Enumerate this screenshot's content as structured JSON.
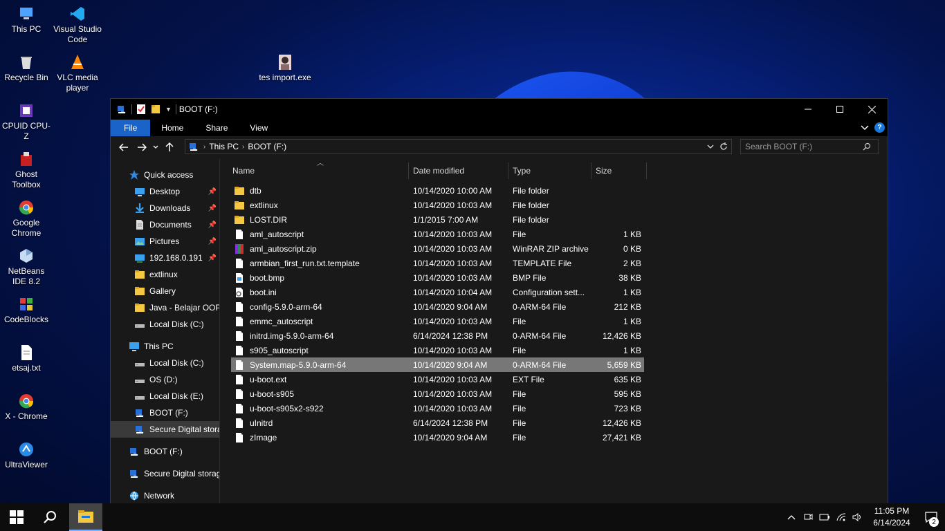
{
  "desktop": {
    "icons": [
      {
        "label": "This PC",
        "icon": "this-pc-icon"
      },
      {
        "label": "Visual Studio Code",
        "icon": "vscode-icon"
      },
      {
        "label": "Recycle Bin",
        "icon": "recycle-bin-icon"
      },
      {
        "label": "VLC media player",
        "icon": "vlc-icon"
      },
      {
        "label": "tes import.exe",
        "icon": "exe-photo-icon"
      },
      {
        "label": "CPUID CPU-Z",
        "icon": "cpuz-icon"
      },
      {
        "label": "Ghost Toolbox",
        "icon": "ghost-toolbox-icon"
      },
      {
        "label": "Google Chrome",
        "icon": "chrome-icon"
      },
      {
        "label": "NetBeans IDE 8.2",
        "icon": "netbeans-icon"
      },
      {
        "label": "CodeBlocks",
        "icon": "codeblocks-icon"
      },
      {
        "label": "etsaj.txt",
        "icon": "text-file-icon"
      },
      {
        "label": "X - Chrome",
        "icon": "chrome-icon"
      },
      {
        "label": "UltraViewer",
        "icon": "ultraviewer-icon"
      }
    ]
  },
  "window": {
    "title": "BOOT (F:)",
    "ribbon_tabs": [
      "File",
      "Home",
      "Share",
      "View"
    ],
    "help_label": "?",
    "breadcrumb": [
      "This PC",
      "BOOT (F:)"
    ],
    "search_placeholder": "Search BOOT (F:)"
  },
  "nav": {
    "quick_access": "Quick access",
    "quick_items": [
      "Desktop",
      "Downloads",
      "Documents",
      "Pictures",
      "192.168.0.191",
      "extlinux",
      "Gallery",
      "Java - Belajar OOP",
      "Local Disk (C:)"
    ],
    "this_pc": "This PC",
    "pc_items": [
      "Local Disk (C:)",
      "OS (D:)",
      "Local Disk (E:)",
      "BOOT (F:)",
      "Secure Digital storag"
    ],
    "boot": "BOOT (F:)",
    "secure": "Secure Digital storage",
    "network": "Network"
  },
  "columns": {
    "name": "Name",
    "date": "Date modified",
    "type": "Type",
    "size": "Size"
  },
  "files": [
    {
      "name": "dtb",
      "date": "10/14/2020 10:00 AM",
      "type": "File folder",
      "size": "",
      "kind": "folder"
    },
    {
      "name": "extlinux",
      "date": "10/14/2020 10:03 AM",
      "type": "File folder",
      "size": "",
      "kind": "folder"
    },
    {
      "name": "LOST.DIR",
      "date": "1/1/2015 7:00 AM",
      "type": "File folder",
      "size": "",
      "kind": "folder"
    },
    {
      "name": "aml_autoscript",
      "date": "10/14/2020 10:03 AM",
      "type": "File",
      "size": "1 KB",
      "kind": "file"
    },
    {
      "name": "aml_autoscript.zip",
      "date": "10/14/2020 10:03 AM",
      "type": "WinRAR ZIP archive",
      "size": "0 KB",
      "kind": "zip"
    },
    {
      "name": "armbian_first_run.txt.template",
      "date": "10/14/2020 10:03 AM",
      "type": "TEMPLATE File",
      "size": "2 KB",
      "kind": "file"
    },
    {
      "name": "boot.bmp",
      "date": "10/14/2020 10:03 AM",
      "type": "BMP File",
      "size": "38 KB",
      "kind": "image"
    },
    {
      "name": "boot.ini",
      "date": "10/14/2020 10:04 AM",
      "type": "Configuration sett...",
      "size": "1 KB",
      "kind": "config"
    },
    {
      "name": "config-5.9.0-arm-64",
      "date": "10/14/2020 9:04 AM",
      "type": "0-ARM-64 File",
      "size": "212 KB",
      "kind": "file"
    },
    {
      "name": "emmc_autoscript",
      "date": "10/14/2020 10:03 AM",
      "type": "File",
      "size": "1 KB",
      "kind": "file"
    },
    {
      "name": "initrd.img-5.9.0-arm-64",
      "date": "6/14/2024 12:38 PM",
      "type": "0-ARM-64 File",
      "size": "12,426 KB",
      "kind": "file"
    },
    {
      "name": "s905_autoscript",
      "date": "10/14/2020 10:03 AM",
      "type": "File",
      "size": "1 KB",
      "kind": "file"
    },
    {
      "name": "System.map-5.9.0-arm-64",
      "date": "10/14/2020 9:04 AM",
      "type": "0-ARM-64 File",
      "size": "5,659 KB",
      "kind": "file",
      "selected": true
    },
    {
      "name": "u-boot.ext",
      "date": "10/14/2020 10:03 AM",
      "type": "EXT File",
      "size": "635 KB",
      "kind": "file"
    },
    {
      "name": "u-boot-s905",
      "date": "10/14/2020 10:03 AM",
      "type": "File",
      "size": "595 KB",
      "kind": "file"
    },
    {
      "name": "u-boot-s905x2-s922",
      "date": "10/14/2020 10:03 AM",
      "type": "File",
      "size": "723 KB",
      "kind": "file"
    },
    {
      "name": "uInitrd",
      "date": "6/14/2024 12:38 PM",
      "type": "File",
      "size": "12,426 KB",
      "kind": "file"
    },
    {
      "name": "zImage",
      "date": "10/14/2020 9:04 AM",
      "type": "File",
      "size": "27,421 KB",
      "kind": "file"
    }
  ],
  "taskbar": {
    "time": "11:05 PM",
    "date": "6/14/2024",
    "notification_count": "2"
  },
  "colors": {
    "accent": "#1a63c8",
    "selection": "#777777",
    "folder": "#f5c842"
  }
}
